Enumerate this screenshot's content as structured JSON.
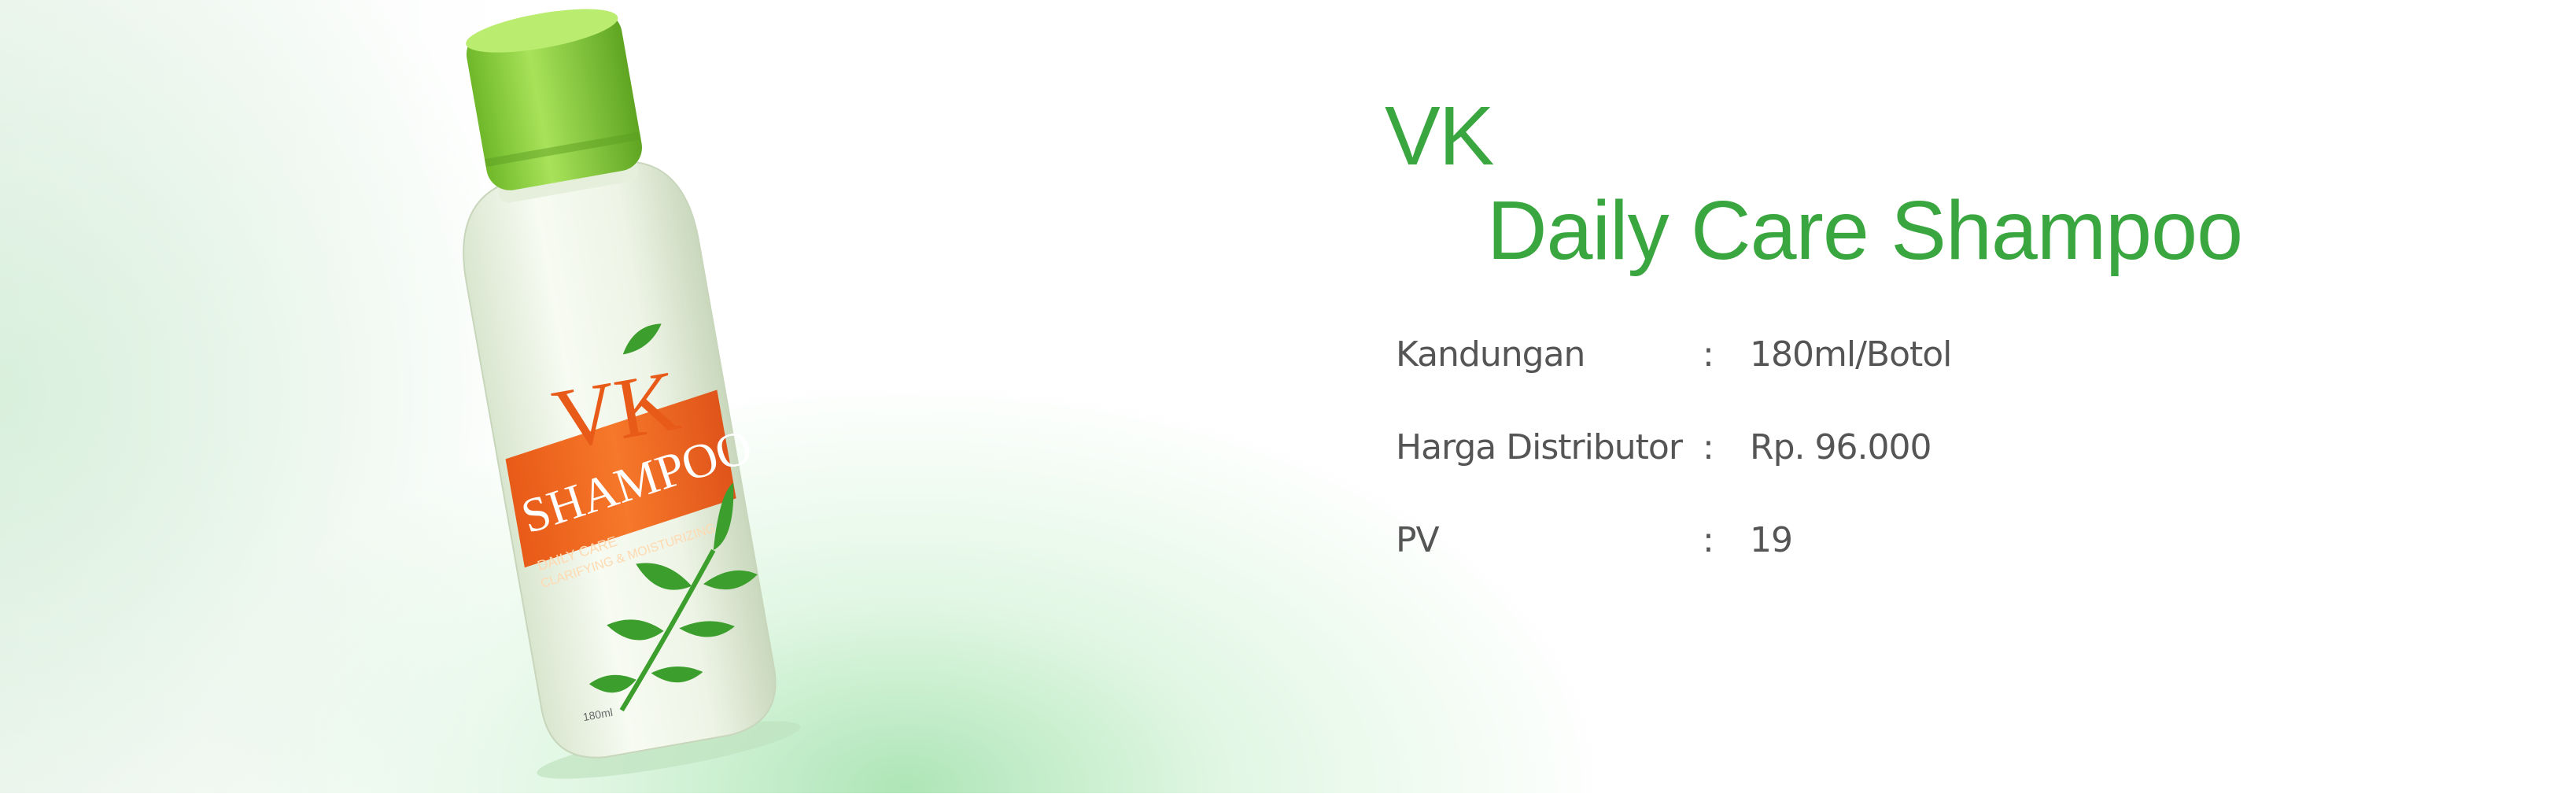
{
  "product": {
    "brand": "VK",
    "name": "Daily Care Shampoo"
  },
  "bottle_label": {
    "brand": "VK",
    "product": "SHAMPOO",
    "line1": "DAILY CARE",
    "line2": "CLARIFYING & MOISTURIZING",
    "volume": "180ml"
  },
  "specs": [
    {
      "label": "Kandungan",
      "separator": ":",
      "value": "180ml/Botol"
    },
    {
      "label": "Harga Distributor",
      "separator": ":",
      "value": "Rp. 96.000"
    },
    {
      "label": "PV",
      "separator": ":",
      "value": "19"
    }
  ],
  "colors": {
    "title_green": "#3aa63f",
    "cap_green": "#8fd13a",
    "label_orange": "#f26b21",
    "leaf_green": "#3c9e2c",
    "spec_text": "#555555"
  }
}
